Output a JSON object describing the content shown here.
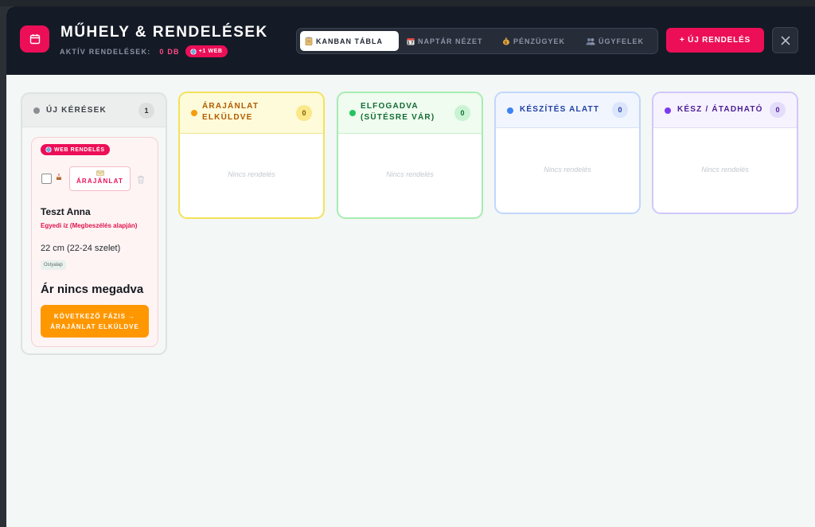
{
  "header": {
    "title": "MŰHELY & RENDELÉSEK",
    "active_label": "AKTÍV RENDELÉSEK:",
    "active_count": "0 DB",
    "web_pill": "+1 WEB",
    "tabs": [
      {
        "label": "KANBAN TÁBLA",
        "icon": "clipboard-icon",
        "active": true
      },
      {
        "label": "NAPTÁR NÉZET",
        "icon": "calendar-icon",
        "active": false
      },
      {
        "label": "PÉNZÜGYEK",
        "icon": "money-bag-icon",
        "active": false
      },
      {
        "label": "ÜGYFELEK",
        "icon": "users-icon",
        "active": false
      }
    ],
    "new_order_label": "+ ÚJ RENDELÉS"
  },
  "columns": [
    {
      "title": "ÚJ KÉRÉSEK",
      "count": "1",
      "color": "#8b8f95"
    },
    {
      "title": "ÁRAJÁNLAT ELKÜLDVE",
      "count": "0",
      "color": "#f59e0b",
      "empty_text": "Nincs rendelés"
    },
    {
      "title": "ELFOGADVA (SÜTÉSRE VÁR)",
      "count": "0",
      "color": "#22c55e",
      "empty_text": "Nincs rendelés"
    },
    {
      "title": "KÉSZÍTÉS ALATT",
      "count": "0",
      "color": "#3b82f6",
      "empty_text": "Nincs rendelés"
    },
    {
      "title": "KÉSZ / ÁTADHATÓ",
      "count": "0",
      "color": "#7c3aed",
      "empty_text": "Nincs rendelés"
    }
  ],
  "order_card": {
    "source_badge": "WEB RENDELÉS",
    "quote_label": "ÁRAJÁNLAT",
    "customer": "Teszt Anna",
    "flavor": "Egyedi íz (Megbeszélés alapján)",
    "size": "22 cm (22-24 szelet)",
    "base": "Ostyalap",
    "price": "Ár nincs megadva",
    "next_line1": "KÖVETKEZŐ FÁZIS →",
    "next_line2": "ÁRAJÁNLAT ELKÜLDVE"
  },
  "colors": {
    "accent": "#ec0f57",
    "header_bg": "#151b26",
    "next_button": "#ff9700"
  }
}
